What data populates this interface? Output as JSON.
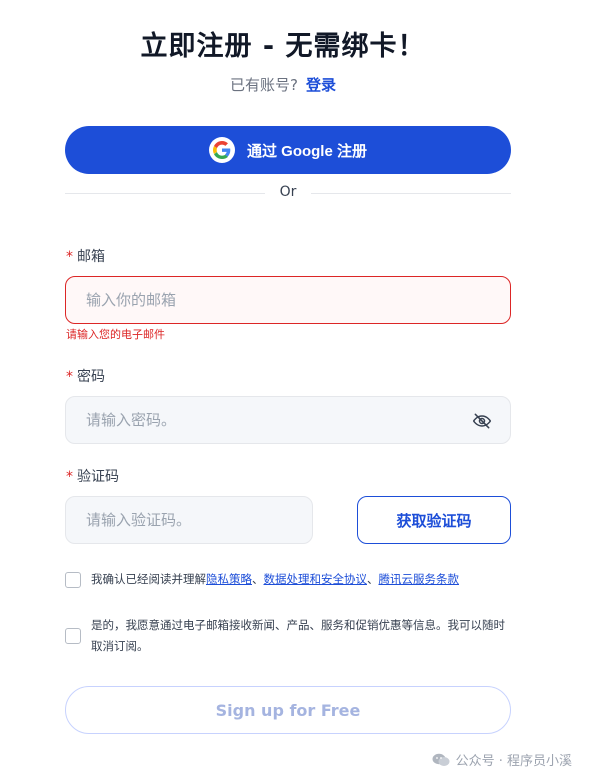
{
  "header": {
    "title": "立即注册 - 无需绑卡！",
    "have_account": "已有账号?",
    "login_link": "登录"
  },
  "google": {
    "label": "通过 Google 注册",
    "icon": "google-icon"
  },
  "divider": {
    "text": "Or"
  },
  "email": {
    "required_mark": "*",
    "label": "邮箱",
    "placeholder": "输入你的邮箱",
    "value": "",
    "error": "请输入您的电子邮件"
  },
  "password": {
    "required_mark": "*",
    "label": "密码",
    "placeholder": "请输入密码。",
    "value": "",
    "toggle_icon": "eye-off-icon"
  },
  "code": {
    "required_mark": "*",
    "label": "验证码",
    "placeholder": "请输入验证码。",
    "value": "",
    "button_label": "获取验证码"
  },
  "consent": {
    "prefix": "我确认已经阅读并理解",
    "link1": "隐私策略",
    "sep1": "、",
    "link2": "数据处理和安全协议",
    "sep2": "、",
    "link3": "腾讯云服务条款",
    "checked": false
  },
  "marketing": {
    "text": "是的，我愿意通过电子邮箱接收新闻、产品、服务和促销优惠等信息。我可以随时取消订阅。",
    "checked": false
  },
  "submit": {
    "label": "Sign up for Free"
  },
  "watermark": {
    "text": "公众号 · 程序员小溪",
    "icon": "wechat-icon"
  },
  "colors": {
    "primary": "#1d4ed8",
    "error": "#dc2626",
    "input_bg": "#f5f7fa"
  }
}
